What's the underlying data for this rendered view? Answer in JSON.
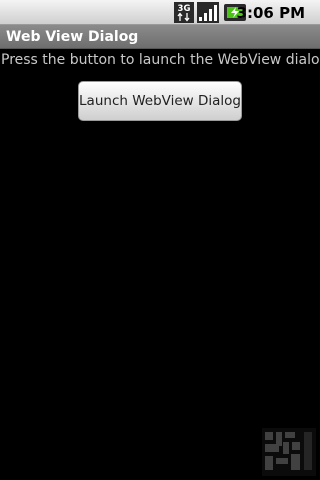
{
  "status_bar": {
    "network_icon": "3g-data-icon",
    "signal_icon": "signal-strength-icon",
    "battery_icon": "battery-charging-icon",
    "network_label": "3G",
    "time": "3:06 PM"
  },
  "app": {
    "title": "Web View Dialog"
  },
  "main": {
    "instruction": "Press the button to launch the WebView dialog:",
    "launch_button_label": "Launch WebView Dialog"
  },
  "colors": {
    "title_bar": "#7b7b7b",
    "background": "#000000",
    "battery_accent": "#4cc417"
  }
}
